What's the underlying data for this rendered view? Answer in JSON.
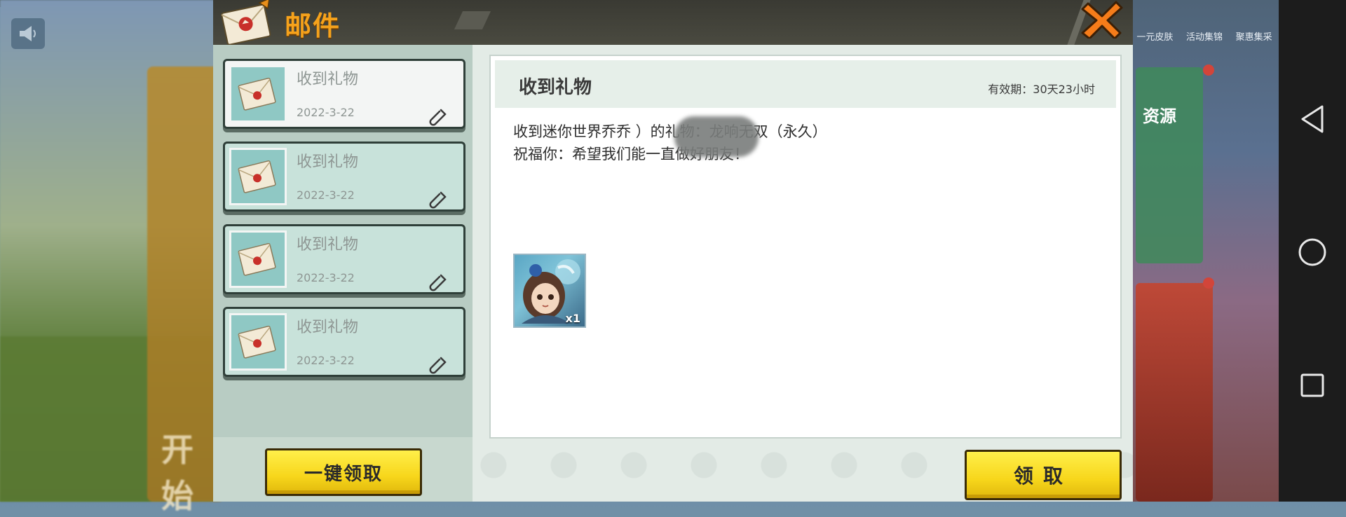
{
  "window": {
    "title": "邮件"
  },
  "mails": [
    {
      "title": "收到礼物",
      "date": "2022-3-22",
      "selected": true
    },
    {
      "title": "收到礼物",
      "date": "2022-3-22",
      "selected": false
    },
    {
      "title": "收到礼物",
      "date": "2022-3-22",
      "selected": false
    },
    {
      "title": "收到礼物",
      "date": "2022-3-22",
      "selected": false
    }
  ],
  "buttons": {
    "claim_all": "一键领取",
    "claim": "领取"
  },
  "detail": {
    "title": "收到礼物",
    "validity": "有效期：30天23小时",
    "message_line1": "收到迷你世界乔乔              ）的礼物：龙响无双（永久）",
    "message_line2": "祝福你：希望我们能一直做好朋友！",
    "gift": {
      "quantity": "x1"
    }
  },
  "background": {
    "top_labels": [
      "一元皮肤",
      "活动集锦",
      "聚惠集采"
    ],
    "resource_label": "资源",
    "open_text": "开始"
  },
  "colors": {
    "title_orange": "#f6a21b",
    "close_orange": "#f57c1a",
    "button_yellow": "#f7d61b"
  },
  "icons": {
    "close": "close-icon",
    "mail": "envelope-icon",
    "clip": "attachment-icon",
    "back": "back-triangle-icon",
    "home": "home-circle-icon",
    "recents": "recents-square-icon"
  }
}
